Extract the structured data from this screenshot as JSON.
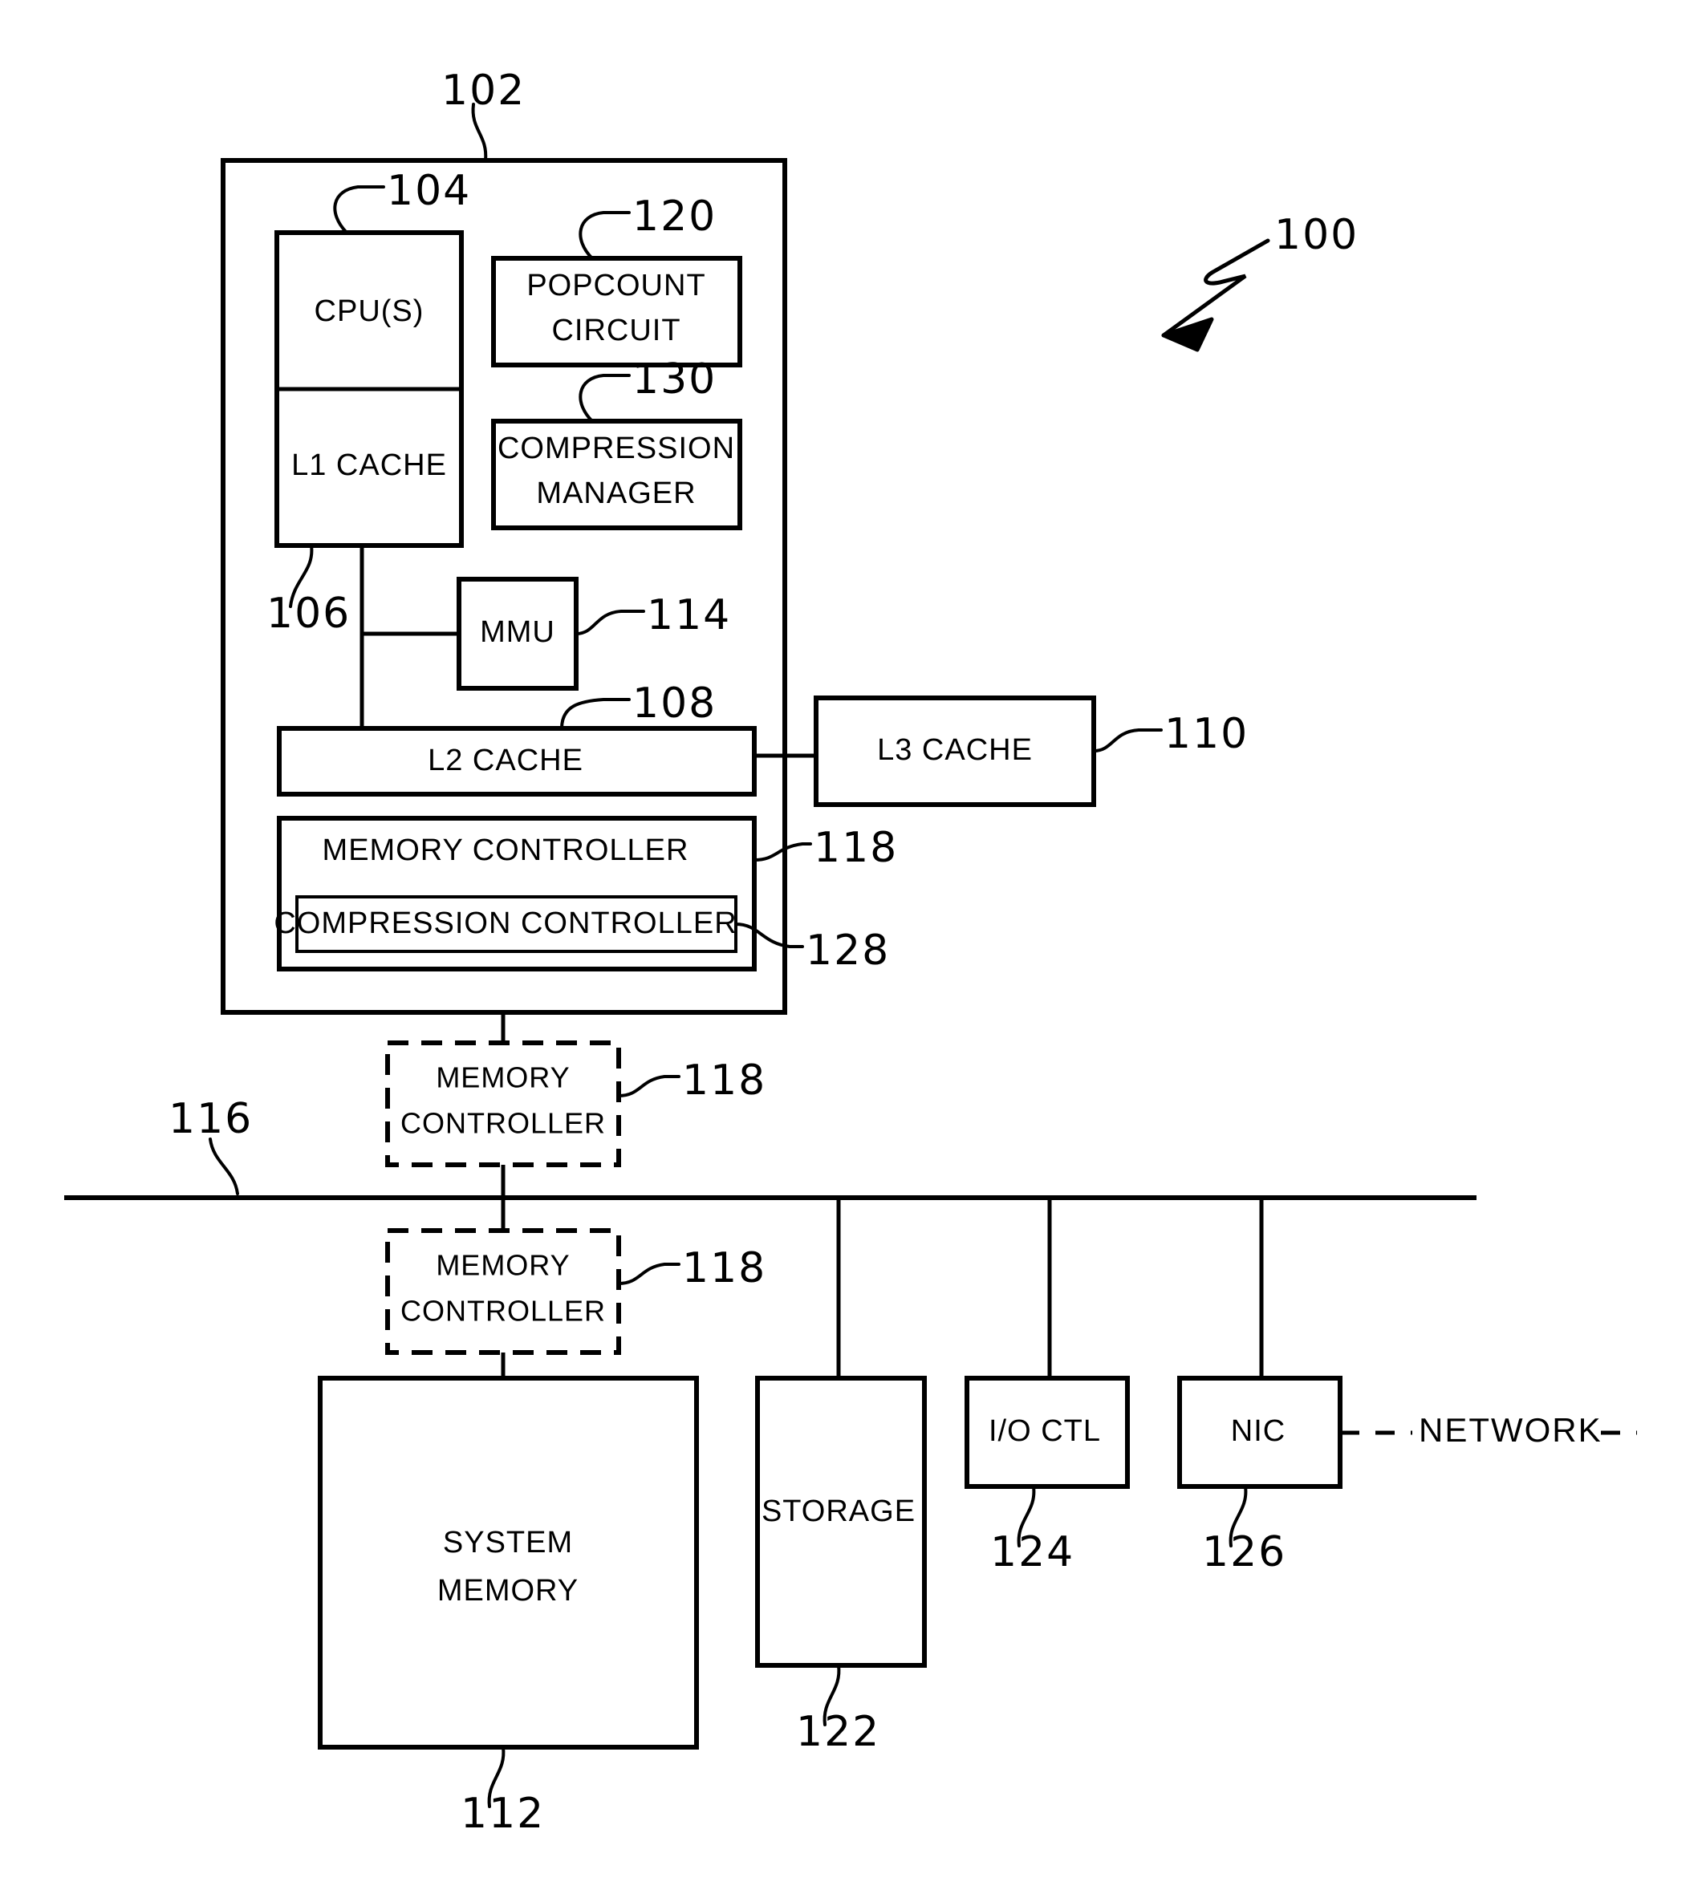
{
  "figure": {
    "overall_ref": "100",
    "blocks": {
      "processor": {
        "ref": "102"
      },
      "cpus": {
        "label": "CPU(S)",
        "ref": "104"
      },
      "l1_cache": {
        "label": "L1 CACHE",
        "ref": "106"
      },
      "popcount": {
        "label_line1": "POPCOUNT",
        "label_line2": "CIRCUIT",
        "ref": "120"
      },
      "compression_manager": {
        "label_line1": "COMPRESSION",
        "label_line2": "MANAGER",
        "ref": "130"
      },
      "mmu": {
        "label": "MMU",
        "ref": "114"
      },
      "l2_cache": {
        "label": "L2 CACHE",
        "ref": "108"
      },
      "l3_cache": {
        "label": "L3 CACHE",
        "ref": "110"
      },
      "memory_controller_internal": {
        "label": "MEMORY CONTROLLER",
        "ref": "118"
      },
      "compression_controller": {
        "label": "COMPRESSION CONTROLLER",
        "ref": "128"
      },
      "memory_controller_above_bus": {
        "label_line1": "MEMORY",
        "label_line2": "CONTROLLER",
        "ref": "118"
      },
      "memory_controller_below_bus": {
        "label_line1": "MEMORY",
        "label_line2": "CONTROLLER",
        "ref": "118"
      },
      "bus": {
        "ref": "116"
      },
      "system_memory": {
        "label_line1": "SYSTEM",
        "label_line2": "MEMORY",
        "ref": "112"
      },
      "storage": {
        "label": "STORAGE",
        "ref": "122"
      },
      "io_ctl": {
        "label": "I/O CTL",
        "ref": "124"
      },
      "nic": {
        "label": "NIC",
        "ref": "126"
      },
      "network": {
        "label": "NETWORK"
      }
    },
    "colors": {
      "ink": "#000000",
      "paper": "#ffffff"
    }
  }
}
